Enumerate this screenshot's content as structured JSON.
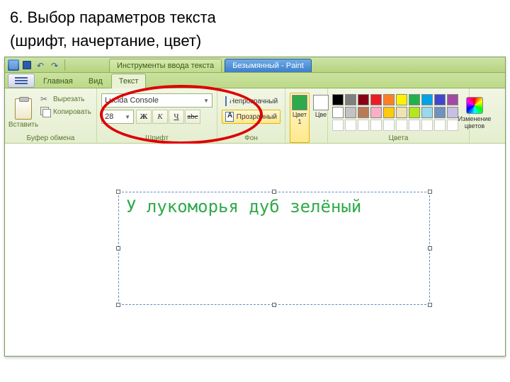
{
  "caption": {
    "line1": "6. Выбор параметров текста",
    "line2": "(шрифт, начертание, цвет)"
  },
  "titlebar": {
    "tools_tab": "Инструменты ввода текста",
    "doc_tab": "Безымянный - Paint"
  },
  "tabs": {
    "main": "Главная",
    "view": "Вид",
    "text": "Текст"
  },
  "clipboard": {
    "paste": "Вставить",
    "cut": "Вырезать",
    "copy": "Копировать",
    "group": "Буфер обмена"
  },
  "font": {
    "family": "Lucida Console",
    "size": "28",
    "bold": "Ж",
    "italic": "К",
    "underline": "Ч",
    "strike": "abc",
    "group": "Шрифт"
  },
  "bg": {
    "opaque": "Непрозрачный",
    "transparent": "Прозрачный",
    "group": "Фон"
  },
  "colors": {
    "c1_label": "Цвет 1",
    "c2_label": "Цве",
    "c1": "#2faa4a",
    "c2": "#ffffff",
    "edit": "Изменение цветов",
    "group": "Цвета",
    "palette_row1": [
      "#000000",
      "#7f7f7f",
      "#880015",
      "#ed1c24",
      "#ff7f27",
      "#fff200",
      "#22b14c",
      "#00a2e8",
      "#3f48cc",
      "#a349a4"
    ],
    "palette_row2": [
      "#ffffff",
      "#c3c3c3",
      "#b97a57",
      "#ffaec9",
      "#ffc90e",
      "#efe4b0",
      "#b5e61d",
      "#99d9ea",
      "#7092be",
      "#c8bfe7"
    ]
  },
  "canvas": {
    "text": "У лукоморья дуб зелёный"
  }
}
